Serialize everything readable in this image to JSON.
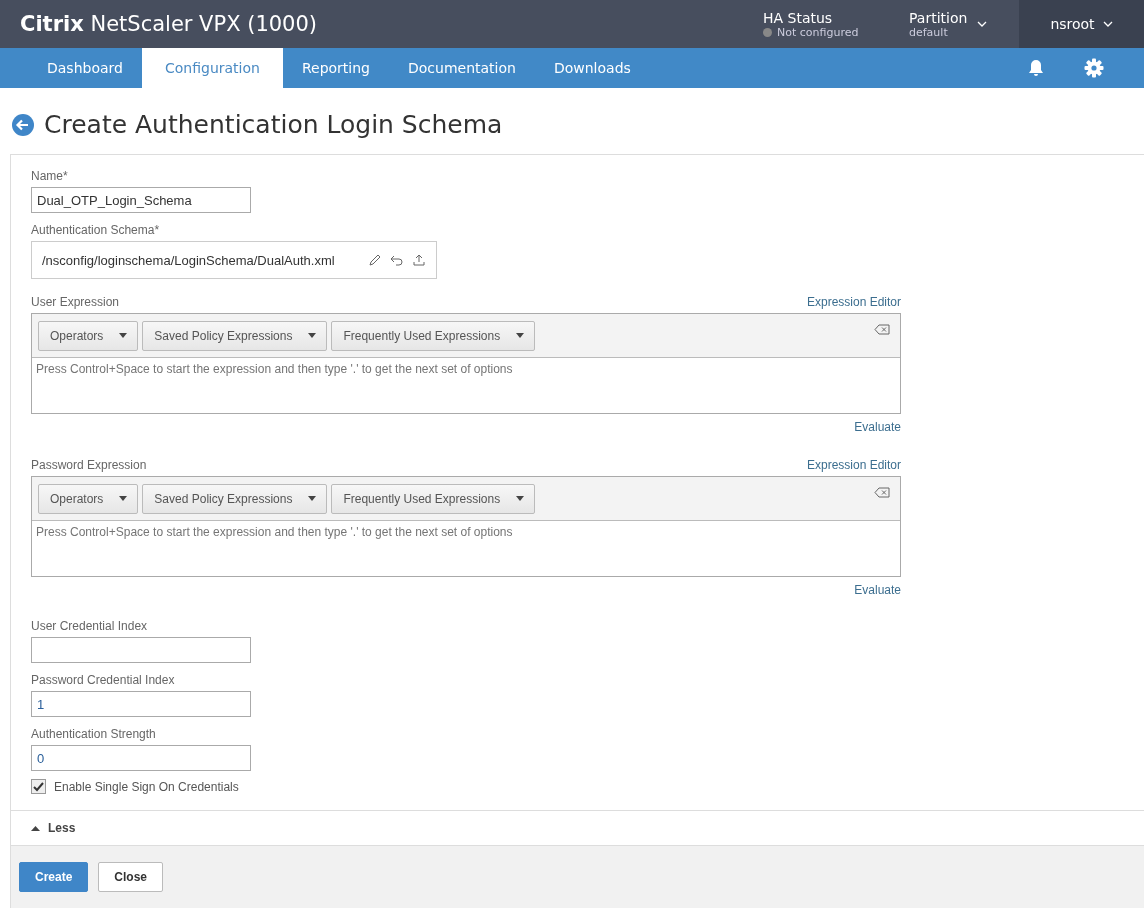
{
  "header": {
    "brand_bold": "Citrix",
    "brand": "NetScaler VPX (1000)",
    "ha_status": {
      "label": "HA Status",
      "value": "Not configured"
    },
    "partition": {
      "label": "Partition",
      "value": "default"
    },
    "user": "nsroot"
  },
  "tabs": [
    {
      "label": "Dashboard",
      "selected": false
    },
    {
      "label": "Configuration",
      "selected": true
    },
    {
      "label": "Reporting",
      "selected": false
    },
    {
      "label": "Documentation",
      "selected": false
    },
    {
      "label": "Downloads",
      "selected": false
    }
  ],
  "page_title": "Create Authentication Login Schema",
  "fields": [
    {
      "kind": "text",
      "label": "Name*",
      "value": "Dual_OTP_Login_Schema"
    },
    {
      "kind": "schema",
      "label": "Authentication Schema*",
      "value": "/nsconfig/loginschema/LoginSchema/DualAuth.xml"
    },
    {
      "kind": "expression",
      "label": "User Expression",
      "editor_link": "Expression Editor",
      "buttons": [
        "Operators",
        "Saved Policy Expressions",
        "Frequently Used Expressions"
      ],
      "placeholder": "Press Control+Space to start the expression and then type '.' to get the next set of options",
      "evaluate": "Evaluate"
    },
    {
      "kind": "expression",
      "label": "Password Expression",
      "editor_link": "Expression Editor",
      "buttons": [
        "Operators",
        "Saved Policy Expressions",
        "Frequently Used Expressions"
      ],
      "placeholder": "Press Control+Space to start the expression and then type '.' to get the next set of options",
      "evaluate": "Evaluate"
    },
    {
      "kind": "text",
      "label": "User Credential Index"
    },
    {
      "kind": "text",
      "label": "Password Credential Index",
      "value": "1"
    },
    {
      "kind": "text",
      "label": "Authentication Strength",
      "value": "0"
    },
    {
      "kind": "checkbox",
      "label": "Enable Single Sign On Credentials",
      "checked": true
    }
  ],
  "less_toggle": {
    "label": "Less",
    "expanded": true
  },
  "buttons": [
    {
      "label": "Create",
      "kind": "primary"
    },
    {
      "label": "Close",
      "kind": "default"
    }
  ]
}
